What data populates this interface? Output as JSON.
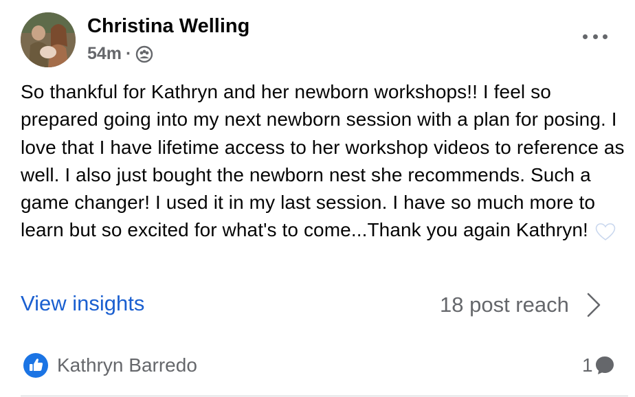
{
  "post": {
    "author": "Christina Welling",
    "time": "54m",
    "separator": "·",
    "audience_icon": "group-icon",
    "more_icon": "more-dots-icon",
    "text": "So thankful for Kathryn and her newborn workshops!! I feel so prepared going into my next newborn session with a plan for posing. I love that I have lifetime access to her workshop videos to reference as well. I also just bought the newborn nest she recommends. Such a game changer! I used it in my last session. I have so much more to learn but so excited for what's to come...Thank you again Kathryn!",
    "emoji_icon": "white-heart-icon"
  },
  "insights": {
    "link_label": "View insights",
    "reach_label": "18 post reach",
    "chevron_icon": "chevron-right-icon"
  },
  "reactions": {
    "icon": "like-icon",
    "reactor": "Kathryn Barredo",
    "comment_count": "1",
    "comment_icon": "comment-bubble-icon"
  },
  "colors": {
    "link": "#1a5fd0",
    "secondary_text": "#65676b",
    "like_blue": "#1b74e4"
  }
}
